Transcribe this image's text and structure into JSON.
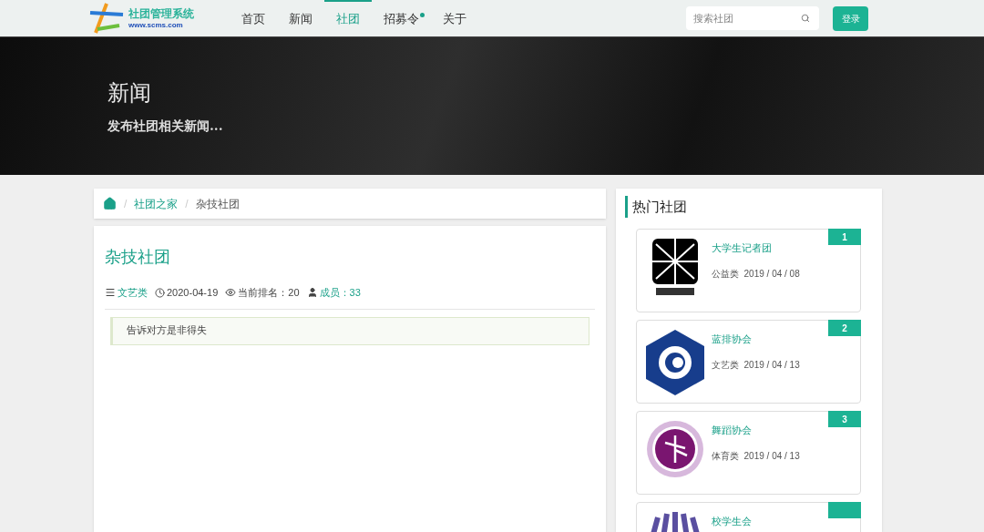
{
  "header": {
    "logo": {
      "title": "社团管理系统",
      "url": "www.scms.com"
    },
    "nav": [
      {
        "label": "首页",
        "selected": false,
        "dot": false
      },
      {
        "label": "新闻",
        "selected": false,
        "dot": false
      },
      {
        "label": "社团",
        "selected": true,
        "dot": false
      },
      {
        "label": "招募令",
        "selected": false,
        "dot": true
      },
      {
        "label": "关于",
        "selected": false,
        "dot": false
      }
    ],
    "search": {
      "placeholder": "搜索社团"
    },
    "login": "登录"
  },
  "banner": {
    "title": "新闻",
    "subtitle": "发布社团相关新闻..."
  },
  "breadcrumb_separator": "/",
  "breadcrumb": [
    {
      "label": "社团之家",
      "link": true
    },
    {
      "label": "杂技社团",
      "link": false
    }
  ],
  "article": {
    "title": "杂技社团",
    "category": "文艺类",
    "date": "2020-04-19",
    "rank": "当前排名：20",
    "members": "成员：33",
    "note": "告诉对方是非得失"
  },
  "hot": {
    "title": "热门社团",
    "clubs": [
      {
        "kind": "grid",
        "name": "大学生记者团",
        "meta": "公益类  2019 / 04 / 08",
        "rank": "1"
      },
      {
        "kind": "hex",
        "name": "蓝排协会",
        "meta": "文艺类  2019 / 04 / 13",
        "rank": "2"
      },
      {
        "kind": "dancer",
        "name": "舞蹈协会",
        "meta": "体育类  2019 / 04 / 13",
        "rank": "3"
      },
      {
        "kind": "hands",
        "name": "校学生会"
      }
    ]
  }
}
